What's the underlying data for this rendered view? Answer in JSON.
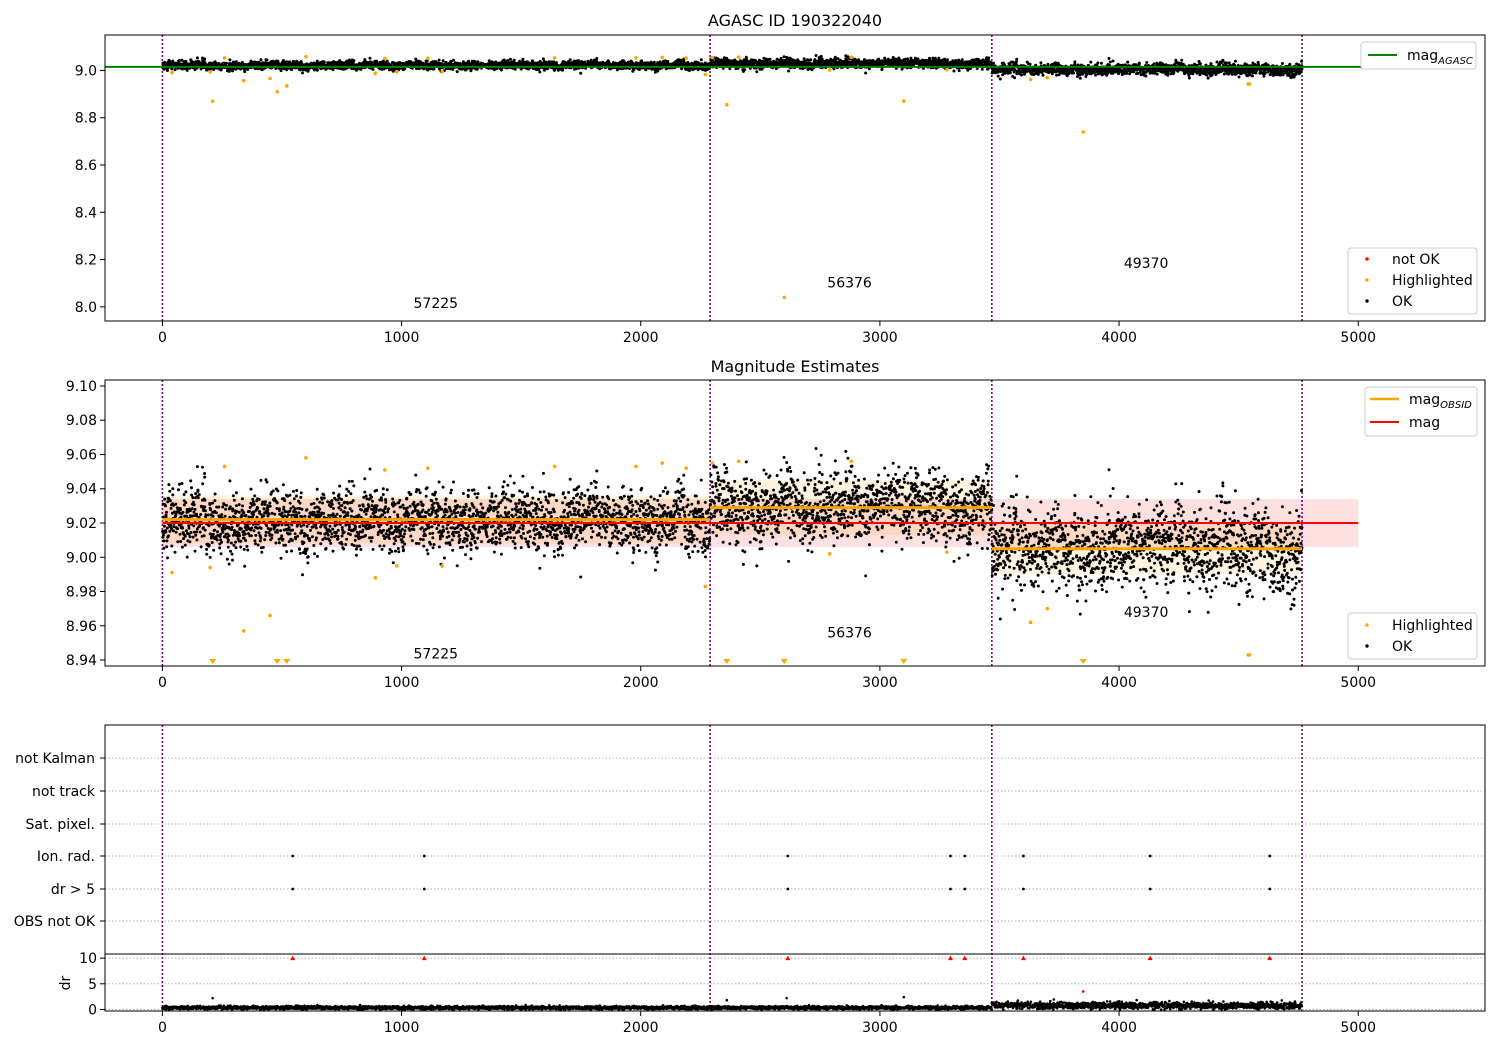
{
  "panels": {
    "top": {
      "title": "AGASC ID 190322040",
      "xticks": [
        0,
        1000,
        2000,
        3000,
        4000,
        5000
      ],
      "xlim": [
        -240,
        5530
      ],
      "ylim": [
        7.94,
        9.15
      ],
      "yticks": [
        8.0,
        8.2,
        8.4,
        8.6,
        8.8,
        9.0
      ],
      "ytick_labels": [
        "8.0",
        "8.2",
        "8.4",
        "8.6",
        "8.8",
        "9.0"
      ],
      "legend_upper": {
        "placement": "top-right",
        "label": "mag",
        "subscript": "AGASC",
        "color": "#008000"
      },
      "legend_lower": {
        "placement": "bottom-right",
        "entries": [
          {
            "label": "not OK",
            "color": "#ff0000"
          },
          {
            "label": "Highlighted",
            "color": "#ffa500"
          },
          {
            "label": "OK",
            "color": "#000000"
          }
        ]
      },
      "obsid_labels": [
        {
          "text": "57225",
          "x": 1050,
          "y": 7.995
        },
        {
          "text": "56376",
          "x": 2780,
          "y": 8.082
        },
        {
          "text": "49370",
          "x": 4020,
          "y": 8.165
        }
      ]
    },
    "middle": {
      "title": "Magnitude Estimates",
      "xticks": [
        0,
        1000,
        2000,
        3000,
        4000,
        5000
      ],
      "xlim": [
        -240,
        5530
      ],
      "ylim": [
        8.9365,
        9.1035
      ],
      "yticks": [
        8.94,
        8.96,
        8.98,
        9.0,
        9.02,
        9.04,
        9.06,
        9.08,
        9.1
      ],
      "ytick_labels": [
        "8.94",
        "8.96",
        "8.98",
        "9.00",
        "9.02",
        "9.04",
        "9.06",
        "9.08",
        "9.10"
      ],
      "legend_upper": {
        "placement": "top-right",
        "entries": [
          {
            "label": "mag",
            "subscript": "OBSID",
            "color": "#ffa500"
          },
          {
            "label": "mag",
            "subscript": "",
            "color": "#ff0000"
          }
        ]
      },
      "legend_lower": {
        "placement": "bottom-right",
        "entries": [
          {
            "label": "Highlighted",
            "color": "#ffa500"
          },
          {
            "label": "OK",
            "color": "#000000"
          }
        ]
      },
      "obsid_labels": [
        {
          "text": "57225",
          "x": 1050,
          "y": 8.941
        },
        {
          "text": "56376",
          "x": 2780,
          "y": 8.953
        },
        {
          "text": "49370",
          "x": 4020,
          "y": 8.965
        }
      ]
    },
    "bottom": {
      "xticks": [
        0,
        1000,
        2000,
        3000,
        4000,
        5000
      ],
      "xlim": [
        -240,
        5530
      ],
      "flag_labels": [
        "not Kalman",
        "not track",
        "Sat. pixel.",
        "Ion. rad.",
        "dr > 5",
        "OBS not OK"
      ],
      "dr_ylabel": "dr",
      "dr_ylim": [
        -0.3,
        10.8
      ],
      "dr_yticks": [
        0,
        5,
        10
      ],
      "dr_ytick_labels": [
        "0",
        "5",
        "10"
      ]
    }
  },
  "chart_data": {
    "type": "scatter",
    "observation_boundaries": [
      0,
      2290,
      3468,
      4765
    ],
    "obsids": [
      "57225",
      "56376",
      "49370"
    ],
    "mag_agasc": 9.015,
    "mag": {
      "value": 9.02,
      "band": [
        9.006,
        9.034
      ],
      "x_range": [
        0,
        5000
      ]
    },
    "mag_obsid": [
      {
        "obsid": "57225",
        "x": [
          0,
          2290
        ],
        "value": 9.022,
        "band": [
          9.008,
          9.036
        ]
      },
      {
        "obsid": "56376",
        "x": [
          2290,
          3468
        ],
        "value": 9.029,
        "band": [
          9.013,
          9.045
        ]
      },
      {
        "obsid": "49370",
        "x": [
          3468,
          4765
        ],
        "value": 9.005,
        "band": [
          8.99,
          9.02
        ]
      }
    ],
    "ok_bands": [
      {
        "x": [
          0,
          2290
        ],
        "center": 9.022,
        "spread": 0.009
      },
      {
        "x": [
          2290,
          3468
        ],
        "center": 9.029,
        "spread": 0.01
      },
      {
        "x": [
          3468,
          4765
        ],
        "center": 9.005,
        "spread": 0.012
      }
    ],
    "highlighted_points": [
      {
        "x": 40,
        "y": 8.991
      },
      {
        "x": 200,
        "y": 8.994
      },
      {
        "x": 210,
        "y": 8.87
      },
      {
        "x": 340,
        "y": 8.957
      },
      {
        "x": 450,
        "y": 8.966
      },
      {
        "x": 480,
        "y": 8.91
      },
      {
        "x": 520,
        "y": 8.935
      },
      {
        "x": 890,
        "y": 8.988
      },
      {
        "x": 980,
        "y": 8.995
      },
      {
        "x": 1170,
        "y": 8.995
      },
      {
        "x": 2270,
        "y": 8.983
      },
      {
        "x": 2360,
        "y": 8.855
      },
      {
        "x": 2600,
        "y": 8.04
      },
      {
        "x": 2790,
        "y": 9.002
      },
      {
        "x": 3100,
        "y": 8.87
      },
      {
        "x": 3280,
        "y": 9.003
      },
      {
        "x": 3630,
        "y": 8.962
      },
      {
        "x": 3700,
        "y": 8.97
      },
      {
        "x": 3850,
        "y": 8.74
      },
      {
        "x": 4540,
        "y": 8.943
      },
      {
        "x": 4545,
        "y": 8.943
      },
      {
        "x": 260,
        "y": 9.053
      },
      {
        "x": 600,
        "y": 9.058
      },
      {
        "x": 930,
        "y": 9.051
      },
      {
        "x": 1110,
        "y": 9.052
      },
      {
        "x": 1640,
        "y": 9.053
      },
      {
        "x": 1980,
        "y": 9.053
      },
      {
        "x": 2090,
        "y": 9.055
      },
      {
        "x": 2190,
        "y": 9.052
      },
      {
        "x": 2300,
        "y": 9.055
      },
      {
        "x": 2410,
        "y": 9.056
      },
      {
        "x": 2880,
        "y": 9.056
      }
    ],
    "flags": {
      "not Kalman": [],
      "not track": [],
      "Sat. pixel.": [],
      "Ion. rad.": [
        545,
        1095,
        2615,
        3295,
        3355,
        3600,
        4130,
        4630
      ],
      "dr > 5": [
        545,
        1095,
        2615,
        3295,
        3355,
        3600,
        4130,
        4630
      ],
      "OBS not OK": []
    },
    "dr": {
      "clipped_at_10": [
        545,
        1095,
        2615,
        3295,
        3355,
        3600,
        4130,
        4630
      ],
      "outliers": [
        {
          "x": 210,
          "y": 2.2
        },
        {
          "x": 2360,
          "y": 1.8
        },
        {
          "x": 2610,
          "y": 2.2
        },
        {
          "x": 3100,
          "y": 2.4
        },
        {
          "x": 3850,
          "y": 3.5
        }
      ],
      "typical": [
        0.35,
        0.35,
        0.75
      ]
    }
  }
}
